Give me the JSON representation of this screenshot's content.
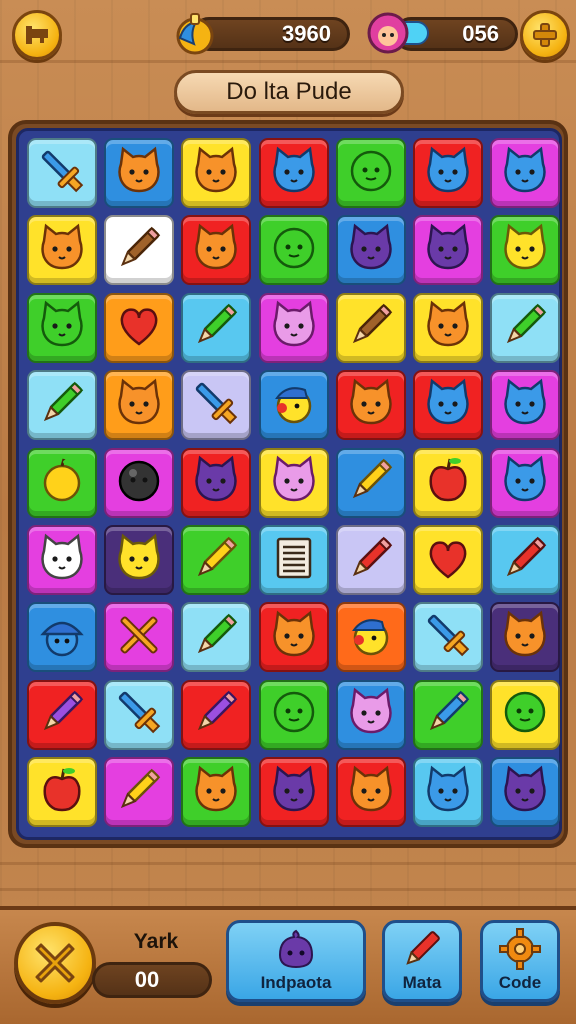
{
  "hud": {
    "coins": "3960",
    "gems": "056",
    "level_title": "Do lta Pude"
  },
  "icons": {
    "left_button": "pennant-icon",
    "coin_badge": "coin-bag-icon",
    "gem_badge": "character-face-icon",
    "right_button": "plus-icon"
  },
  "board": {
    "rows": [
      [
        {
          "bg": "#8fe0f6",
          "icon": "sword"
        },
        {
          "bg": "#2f8fe0",
          "icon": "cat-orange"
        },
        {
          "bg": "#ffe22a",
          "icon": "cat-orange"
        },
        {
          "bg": "#f02222",
          "icon": "cat-blue"
        },
        {
          "bg": "#3fcf2a",
          "icon": "blob-green"
        },
        {
          "bg": "#f02222",
          "icon": "cat-blue"
        },
        {
          "bg": "#e43fe0",
          "icon": "cat-blue"
        }
      ],
      [
        {
          "bg": "#ffe22a",
          "icon": "cat-orange"
        },
        {
          "bg": "#ffffff",
          "icon": "pencil-brown"
        },
        {
          "bg": "#f02222",
          "icon": "cat-orange"
        },
        {
          "bg": "#3fcf2a",
          "icon": "blob-green"
        },
        {
          "bg": "#2f8fe0",
          "icon": "cat-purple"
        },
        {
          "bg": "#e43fe0",
          "icon": "cat-purple"
        },
        {
          "bg": "#3fcf2a",
          "icon": "cat-yellow"
        }
      ],
      [
        {
          "bg": "#3fcf2a",
          "icon": "cat-green"
        },
        {
          "bg": "#ff9d1a",
          "icon": "heart-red"
        },
        {
          "bg": "#58c8f0",
          "icon": "pencil-green"
        },
        {
          "bg": "#e43fe0",
          "icon": "cat-pink"
        },
        {
          "bg": "#ffe22a",
          "icon": "pencil-brown"
        },
        {
          "bg": "#ffe22a",
          "icon": "cat-orange"
        },
        {
          "bg": "#8fe0f6",
          "icon": "pencil-green"
        }
      ],
      [
        {
          "bg": "#8fe0f6",
          "icon": "pencil-green"
        },
        {
          "bg": "#ff9d1a",
          "icon": "cat-orange"
        },
        {
          "bg": "#c9c6f5",
          "icon": "sword"
        },
        {
          "bg": "#2f8fe0",
          "icon": "chick-yellow"
        },
        {
          "bg": "#f02222",
          "icon": "cat-orange"
        },
        {
          "bg": "#f02222",
          "icon": "cat-blue"
        },
        {
          "bg": "#e43fe0",
          "icon": "cat-blue"
        }
      ],
      [
        {
          "bg": "#3fcf2a",
          "icon": "fruit-yellow"
        },
        {
          "bg": "#e43fe0",
          "icon": "ball-black"
        },
        {
          "bg": "#f02222",
          "icon": "cat-purple"
        },
        {
          "bg": "#ffe22a",
          "icon": "cat-pink"
        },
        {
          "bg": "#2f8fe0",
          "icon": "pencil-yellow"
        },
        {
          "bg": "#ffe22a",
          "icon": "apple-red"
        },
        {
          "bg": "#e43fe0",
          "icon": "cat-blue"
        }
      ],
      [
        {
          "bg": "#e43fe0",
          "icon": "cat-white"
        },
        {
          "bg": "#4a2f7a",
          "icon": "cat-yellow"
        },
        {
          "bg": "#3fcf2a",
          "icon": "pencil-yellow"
        },
        {
          "bg": "#58c8f0",
          "icon": "notepad"
        },
        {
          "bg": "#c9c6f5",
          "icon": "pencil-red"
        },
        {
          "bg": "#ffe22a",
          "icon": "heart-red"
        },
        {
          "bg": "#58c8f0",
          "icon": "pencil-red"
        }
      ],
      [
        {
          "bg": "#2f8fe0",
          "icon": "wizard-blue"
        },
        {
          "bg": "#e43fe0",
          "icon": "crossed-swords"
        },
        {
          "bg": "#8fe0f6",
          "icon": "pencil-green"
        },
        {
          "bg": "#f02222",
          "icon": "cat-orange"
        },
        {
          "bg": "#ff6a1a",
          "icon": "chick-yellow"
        },
        {
          "bg": "#8fe0f6",
          "icon": "sword"
        },
        {
          "bg": "#4a2f7a",
          "icon": "cat-orange"
        }
      ],
      [
        {
          "bg": "#f02222",
          "icon": "pencil-purple"
        },
        {
          "bg": "#8fe0f6",
          "icon": "sword"
        },
        {
          "bg": "#f02222",
          "icon": "pencil-purple"
        },
        {
          "bg": "#3fcf2a",
          "icon": "blob-green"
        },
        {
          "bg": "#2f8fe0",
          "icon": "cat-pink"
        },
        {
          "bg": "#3fcf2a",
          "icon": "pencil-blue"
        },
        {
          "bg": "#ffe22a",
          "icon": "blob-green"
        }
      ],
      [
        {
          "bg": "#ffe22a",
          "icon": "apple-red"
        },
        {
          "bg": "#e43fe0",
          "icon": "pencil-yellow"
        },
        {
          "bg": "#3fcf2a",
          "icon": "cat-orange"
        },
        {
          "bg": "#f02222",
          "icon": "cat-purple"
        },
        {
          "bg": "#f02222",
          "icon": "cat-orange"
        },
        {
          "bg": "#58c8f0",
          "icon": "cat-blue"
        },
        {
          "bg": "#2f8fe0",
          "icon": "cat-purple"
        }
      ]
    ]
  },
  "bottom": {
    "score_label": "Yark",
    "score_value": "00",
    "close_icon": "close-x-icon",
    "buttons": [
      {
        "label": "Indpaota",
        "icon": "purple-blob-icon"
      },
      {
        "label": "Mata",
        "icon": "pencil-icon"
      },
      {
        "label": "Code",
        "icon": "gear-icon"
      }
    ]
  }
}
